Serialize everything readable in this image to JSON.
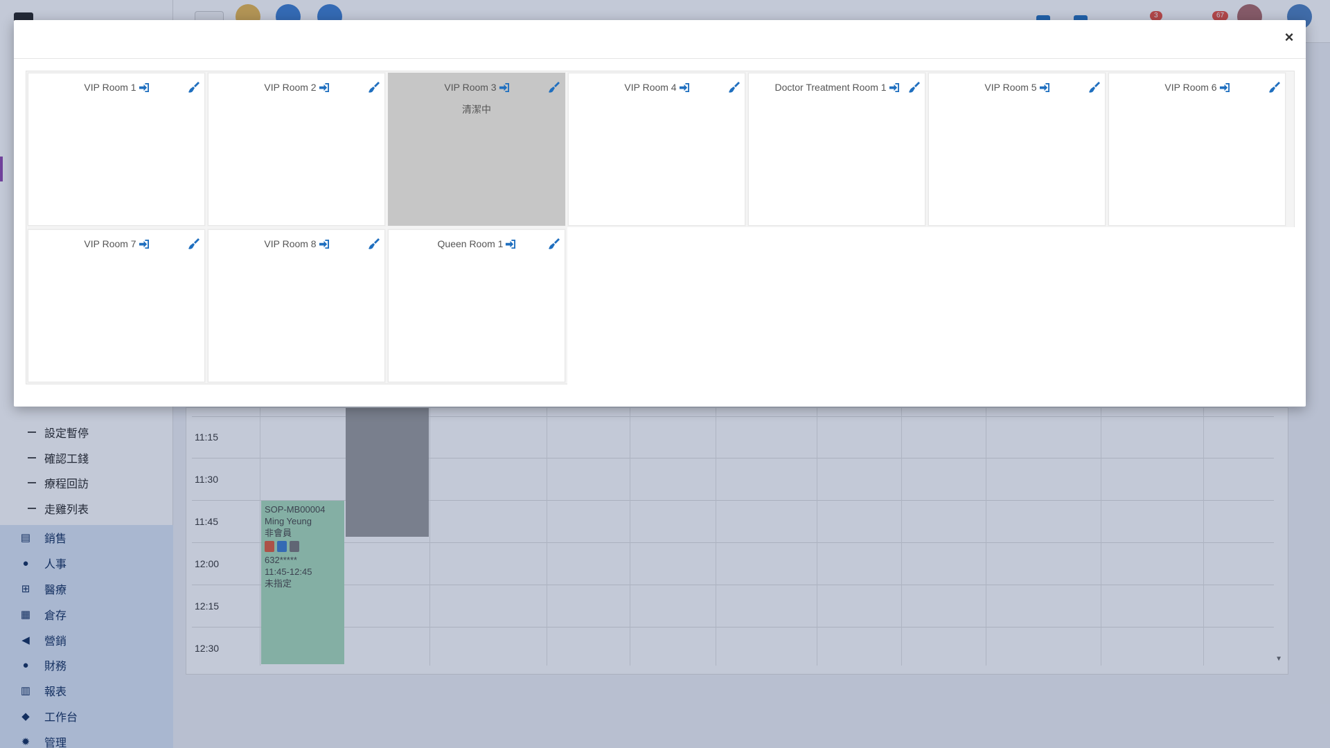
{
  "sidebar": {
    "sub_items": [
      "設定暫停",
      "確認工錢",
      "療程回訪",
      "走雞列表"
    ],
    "menu": [
      {
        "label": "銷售",
        "icon": "sales-icon"
      },
      {
        "label": "人事",
        "icon": "user-icon"
      },
      {
        "label": "醫療",
        "icon": "medical-icon"
      },
      {
        "label": "倉存",
        "icon": "warehouse-icon"
      },
      {
        "label": "營銷",
        "icon": "megaphone-icon"
      },
      {
        "label": "財務",
        "icon": "users-icon"
      },
      {
        "label": "報表",
        "icon": "chart-icon"
      },
      {
        "label": "工作台",
        "icon": "layers-icon"
      },
      {
        "label": "管理",
        "icon": "gear-icon"
      }
    ]
  },
  "topbar": {
    "badge_messages": "3",
    "badge_notifications": "67"
  },
  "calendar": {
    "times": [
      "11:15",
      "11:30",
      "11:45",
      "12:00",
      "12:15",
      "12:30"
    ],
    "appointment": {
      "code": "SOP-MB00004",
      "name": "Ming Yeung",
      "member": "非會員",
      "phone": "632*****",
      "time": "11:45-12:45",
      "staff": "未指定"
    }
  },
  "modal": {
    "close_label": "×",
    "rooms": [
      {
        "name": "VIP Room 1",
        "status": ""
      },
      {
        "name": "VIP Room 2",
        "status": ""
      },
      {
        "name": "VIP Room 3",
        "status": "清潔中"
      },
      {
        "name": "VIP Room 4",
        "status": ""
      },
      {
        "name": "Doctor Treatment Room 1",
        "status": ""
      },
      {
        "name": "VIP Room 5",
        "status": ""
      },
      {
        "name": "VIP Room 6",
        "status": ""
      },
      {
        "name": "VIP Room 7",
        "status": ""
      },
      {
        "name": "VIP Room 8",
        "status": ""
      },
      {
        "name": "Queen Room 1",
        "status": ""
      }
    ]
  },
  "colors": {
    "accent": "#1f6fbf",
    "cleaning_bg": "#c6c6c6"
  }
}
